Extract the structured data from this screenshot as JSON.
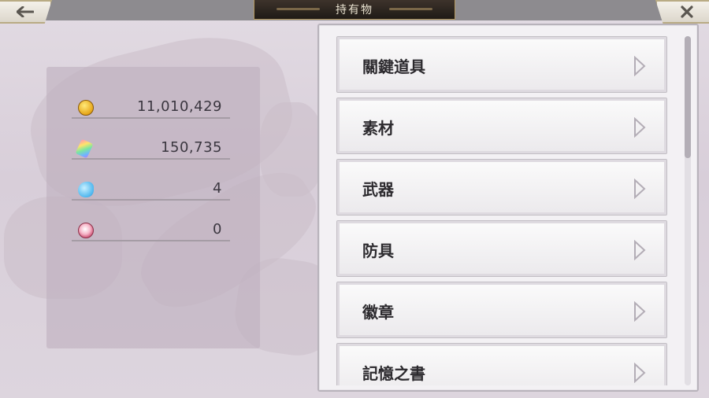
{
  "header": {
    "title": "持有物",
    "back_icon": "arrow-left-icon",
    "close_icon": "close-icon"
  },
  "currencies": [
    {
      "icon": "gold-coin-icon",
      "value": "11,010,429"
    },
    {
      "icon": "crystal-icon",
      "value": "150,735"
    },
    {
      "icon": "fish-token-icon",
      "value": "4"
    },
    {
      "icon": "pink-orb-icon",
      "value": "0"
    }
  ],
  "categories": [
    {
      "label": "關鍵道具"
    },
    {
      "label": "素材"
    },
    {
      "label": "武器"
    },
    {
      "label": "防具"
    },
    {
      "label": "徽章"
    },
    {
      "label": "記憶之書"
    }
  ],
  "colors": {
    "title_plate": "#2a231d",
    "title_border": "#b49960",
    "panel_bg": "#f3f1f4",
    "text": "#2c2a2e"
  },
  "scroll": {
    "position_fraction": 0.0
  }
}
